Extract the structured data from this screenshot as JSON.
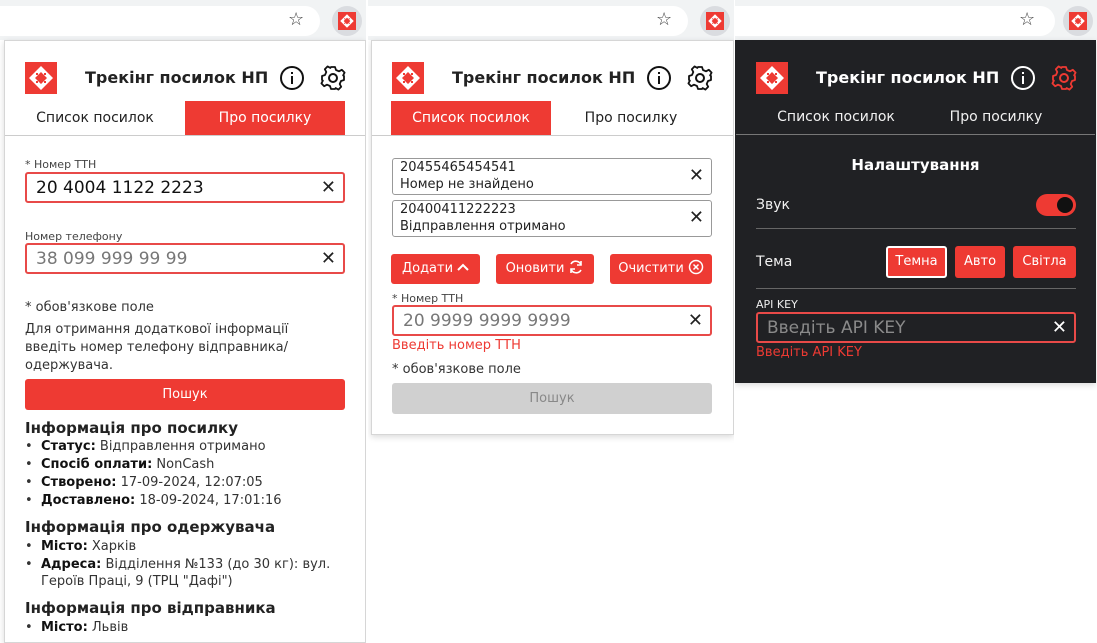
{
  "colors": {
    "accent": "#ee3a33",
    "dark_bg": "#202124",
    "browser_bar": "#f1f3f4"
  },
  "app": {
    "title": "Трекінг посилок НП"
  },
  "tabs": {
    "list": "Список посилок",
    "about": "Про посилку"
  },
  "panel1": {
    "ttn_label": "* Номер ТТН",
    "ttn_value": "20 4004 1122 2223",
    "phone_label": "Номер телефону",
    "phone_value": "38 099 999 99 99",
    "required_note": "* обов'язкове поле",
    "hint_line1": "Для отримання додаткової інформації",
    "hint_line2": "введіть номер телефону відправника/",
    "hint_line3": "одержувача.",
    "search_button": "Пошук",
    "parcel_heading": "Інформація про посилку",
    "status_key": "Статус:",
    "status_value": "Відправлення отримано",
    "payment_key": "Спосіб оплати:",
    "payment_value": "NonCash",
    "created_key": "Створено:",
    "created_value": "17-09-2024, 12:07:05",
    "delivered_key": "Доставлено:",
    "delivered_value": "18-09-2024, 17:01:16",
    "recipient_heading": "Інформація про одержувача",
    "city_key": "Місто:",
    "recipient_city": "Харків",
    "address_key": "Адреса:",
    "address_line1": "Відділення №133 (до 30 кг): вул.",
    "address_line2": "Героїв Праці, 9 (ТРЦ \"Дафі\")",
    "sender_heading": "Інформація про відправника",
    "sender_city": "Львів"
  },
  "panel2": {
    "items": [
      {
        "number": "20455465454541",
        "status": "Номер не знайдено"
      },
      {
        "number": "20400411222223",
        "status": "Відправлення отримано"
      }
    ],
    "add_button": "Додати",
    "refresh_button": "Оновити",
    "clear_button": "Очистити",
    "ttn_label": "* Номер ТТН",
    "ttn_value": "20 9999 9999 9999",
    "ttn_error": "Введіть номер ТТН",
    "required_note": "* обов'язкове поле",
    "search_button": "Пошук"
  },
  "panel3": {
    "settings_heading": "Налаштування",
    "sound_label": "Звук",
    "sound_enabled": true,
    "theme_label": "Тема",
    "theme_options": [
      "Темна",
      "Авто",
      "Світла"
    ],
    "theme_selected": "Темна",
    "api_label": "API KEY",
    "api_placeholder": "Введіть API KEY",
    "api_error": "Введіть API KEY"
  }
}
